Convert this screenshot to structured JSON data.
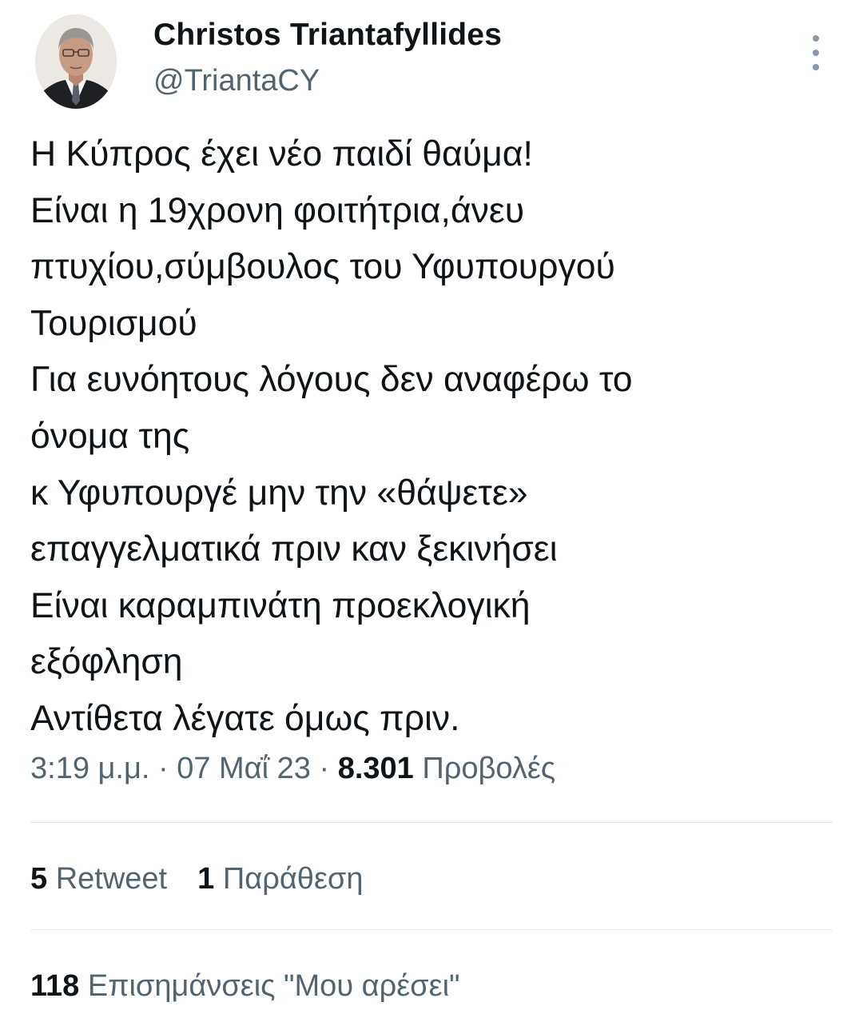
{
  "author": {
    "display_name": "Christos Triantafyllides",
    "handle": "@TriantaCY"
  },
  "tweet": {
    "lines": [
      "Η Κύπρος έχει νέο παιδί θαύμα!",
      "Είναι η 19χρονη φοιτήτρια,άνευ",
      "πτυχίου,σύμβουλος του Υφυπουργού",
      "Τουρισμού",
      "Για ευνόητους λόγους δεν αναφέρω το",
      "όνομα της",
      "κ Υφυπουργέ μην την «θάψετε»",
      "επαγγελματικά πριν καν ξεκινήσει",
      "Είναι καραμπινάτη προεκλογική",
      "εξόφληση",
      "Αντίθετα λέγατε όμως πριν."
    ]
  },
  "meta": {
    "time": "3:19 μ.μ.",
    "separator": " · ",
    "date": "07 Μαΐ 23",
    "views_count": "8.301",
    "views_label": "Προβολές"
  },
  "stats": {
    "retweets_count": "5",
    "retweets_label": "Retweet",
    "quotes_count": "1",
    "quotes_label": "Παράθεση",
    "likes_count": "118",
    "likes_label": "Επισημάνσεις \"Μου αρέσει\""
  },
  "icons": {
    "more": "more-vertical-icon"
  },
  "colors": {
    "primary_text": "#0f1419",
    "secondary_text": "#536471",
    "divider": "#e1e6ea",
    "background": "#ffffff"
  }
}
